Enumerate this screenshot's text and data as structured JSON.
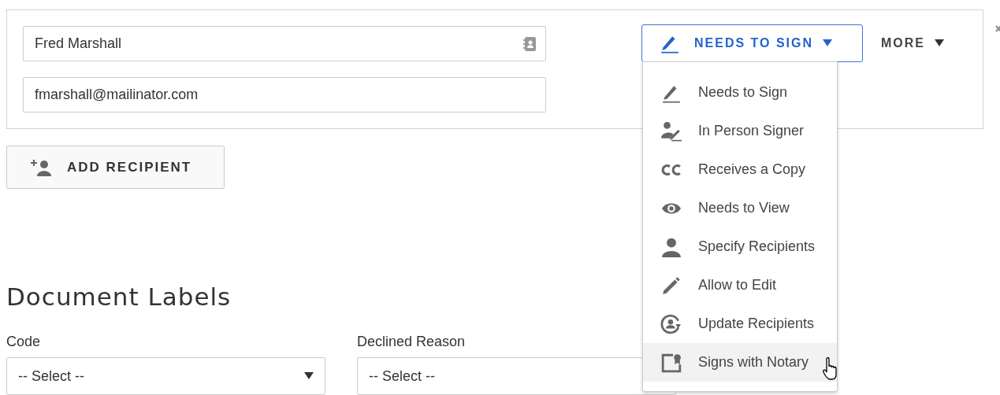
{
  "recipient": {
    "name": "Fred Marshall",
    "email": "fmarshall@mailinator.com"
  },
  "role_button": {
    "label": "NEEDS TO SIGN"
  },
  "more_button": {
    "label": "MORE"
  },
  "role_menu": [
    {
      "label": "Needs to Sign",
      "kind": "sign",
      "highlighted": false
    },
    {
      "label": "In Person Signer",
      "kind": "inperson",
      "highlighted": false
    },
    {
      "label": "Receives a Copy",
      "kind": "cc",
      "highlighted": false
    },
    {
      "label": "Needs to View",
      "kind": "view",
      "highlighted": false
    },
    {
      "label": "Specify Recipients",
      "kind": "person",
      "highlighted": false
    },
    {
      "label": "Allow to Edit",
      "kind": "edit",
      "highlighted": false
    },
    {
      "label": "Update Recipients",
      "kind": "update",
      "highlighted": false
    },
    {
      "label": "Signs with Notary",
      "kind": "notary",
      "highlighted": true
    }
  ],
  "add_recipient": {
    "label": "ADD RECIPIENT"
  },
  "document_labels": {
    "title": "Document Labels",
    "fields": [
      {
        "label": "Code",
        "value": "-- Select --"
      },
      {
        "label": "Declined Reason",
        "value": "-- Select --"
      }
    ]
  }
}
